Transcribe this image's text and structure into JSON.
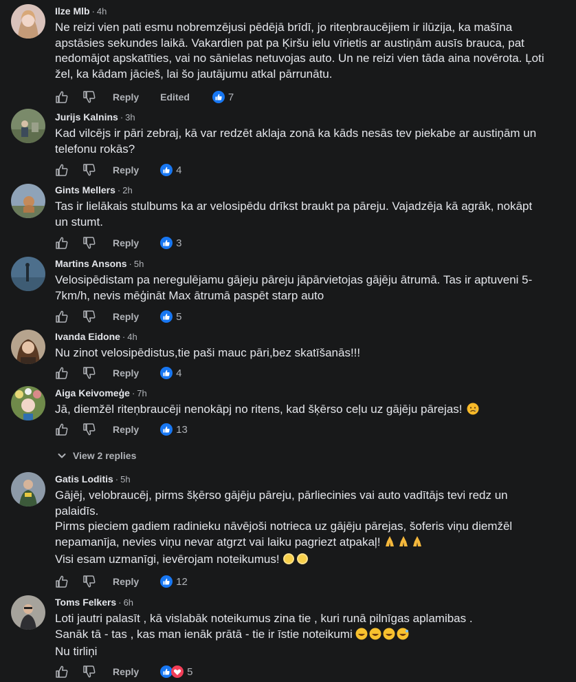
{
  "labels": {
    "reply": "Reply",
    "edited": "Edited",
    "separator": "·"
  },
  "comments": [
    {
      "name": "Ilze Mlb",
      "time": "4h",
      "lines": [
        "Ne reizi vien pati esmu nobremzējusi pēdējā brīdī, jo riteņbraucējiem ir ilūzija, ka mašīna apstāsies sekundes laikā. Vakardien pat pa Ķiršu ielu vīrietis ar austiņām ausīs brauca, pat nedomājot apskatīties, vai no sānielas netuvojas auto. Un ne reizi vien tāda aina novērota. Ļoti žel, ka kādam jācieš, lai šo jautājumu atkal pārrunātu."
      ],
      "edited": true,
      "reactions": [
        "like"
      ],
      "reaction_count": "7"
    },
    {
      "name": "Jurijs Kalnins",
      "time": "3h",
      "lines": [
        "Kad vilcējs ir pāri zebraj, kā var redzēt aklaja zonā ka kāds nesās tev piekabe ar austiņām un telefonu rokās?"
      ],
      "edited": false,
      "reactions": [
        "like"
      ],
      "reaction_count": "4"
    },
    {
      "name": "Gints Mellers",
      "time": "2h",
      "lines": [
        "Tas ir lielākais stulbums ka ar velosipēdu drīkst braukt pa pāreju. Vajadzēja kā agrāk, nokāpt un stumt."
      ],
      "edited": false,
      "reactions": [
        "like"
      ],
      "reaction_count": "3"
    },
    {
      "name": "Martins Ansons",
      "time": "5h",
      "lines": [
        "Velosipēdistam pa neregulējamu gājeju pāreju jāpārvietojas gājēju ātrumā. Tas ir aptuveni 5-7km/h, nevis mēģināt Max ātrumā paspēt starp auto"
      ],
      "edited": false,
      "reactions": [
        "like"
      ],
      "reaction_count": "5"
    },
    {
      "name": "Ivanda Eidone",
      "time": "4h",
      "lines": [
        "Nu zinot velosipēdistus,tie paši mauc pāri,bez skatīšanās!!!"
      ],
      "edited": false,
      "reactions": [
        "like"
      ],
      "reaction_count": "4"
    },
    {
      "name": "Aiga Keivomeģe",
      "time": "7h",
      "lines": [
        "Jā, diemžēl riteņbraucēji nenokāpj no ritens, kad šķērso ceļu uz gājēju pārejas!"
      ],
      "emoji": [
        "sad-face"
      ],
      "edited": false,
      "reactions": [
        "like"
      ],
      "reaction_count": "13"
    },
    {
      "name": "Gatis Loditis",
      "time": "5h",
      "lines": [
        "Gājēj, velobraucēj, pirms šķērso gājēju pāreju, pārliecinies vai auto vadītājs tevi redz un palaidīs.",
        "Pirms pieciem gadiem radinieku nāvējoši notrieca uz gājēju pārejas, šoferis viņu diemžēl nepamanīja, nevies viņu nevar atgrzt vai laiku pagriezt atpakaļ!",
        "Visi esam uzmanīgi, ievērojam noteikumus!"
      ],
      "edited": false,
      "reactions": [
        "like"
      ],
      "reaction_count": "12"
    },
    {
      "name": "Toms Felkers",
      "time": "6h",
      "lines": [
        "Loti jautri palasīt , kā vislabāk noteikumus zina tie , kuri runā pilnīgas aplamibas .",
        "Sanāk tā - tas , kas man ienāk prātā - tie ir īstie noteikumi",
        "Nu tirliņi"
      ],
      "edited": false,
      "reactions": [
        "like",
        "love"
      ],
      "reaction_count": "5"
    }
  ],
  "view_replies": "View 2 replies",
  "colors": {
    "background": "#18191a",
    "text": "#e4e6eb",
    "secondary": "#b0b3b8",
    "like_blue": "#1877f2",
    "love_red": "#f33e58"
  }
}
